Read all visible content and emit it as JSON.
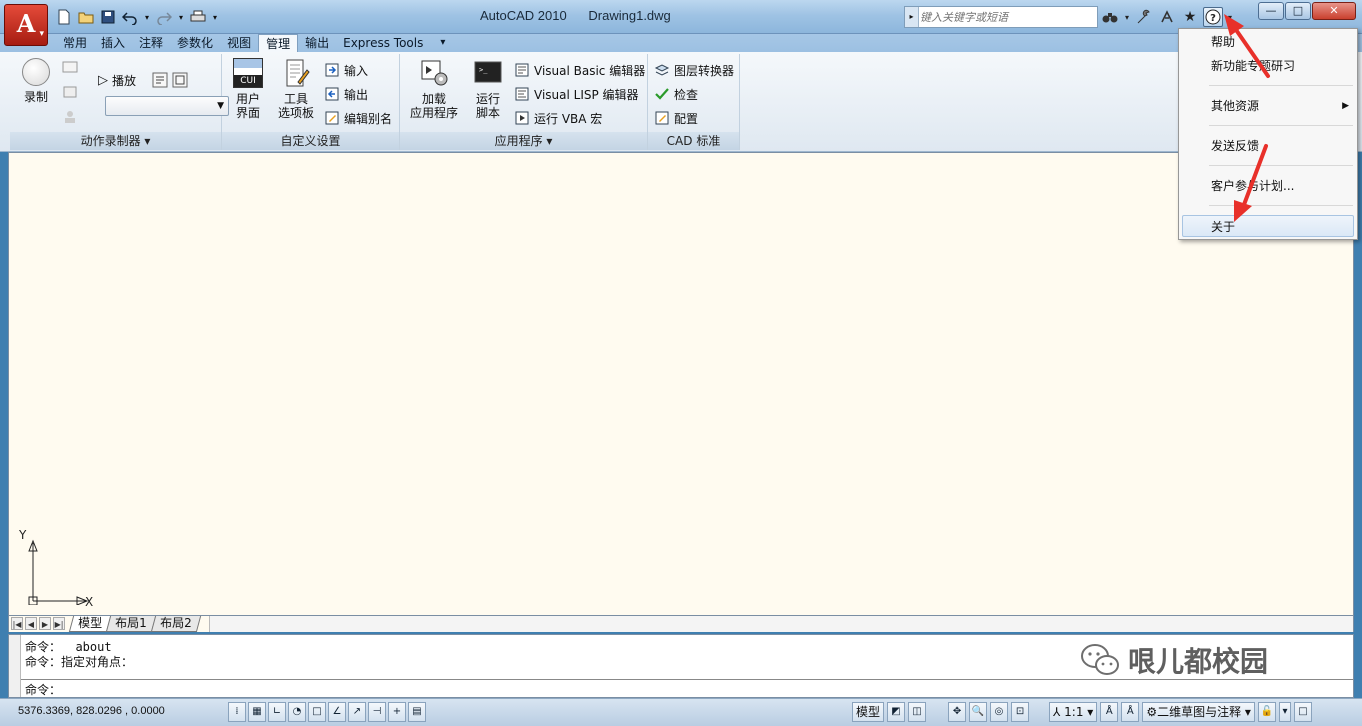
{
  "window": {
    "app_name": "AutoCAD 2010",
    "document": "Drawing1.dwg",
    "app_button_letter": "A",
    "minimize": "—",
    "maximize": "□",
    "close": "✕"
  },
  "search": {
    "placeholder": "键入关键字或短语"
  },
  "tabs": [
    "常用",
    "插入",
    "注释",
    "参数化",
    "视图",
    "管理",
    "输出",
    "Express Tools"
  ],
  "active_tab": "管理",
  "ribbon": {
    "record_label": "录制",
    "play_label": "播放",
    "cui_badge": "CUI",
    "user_interface_label": [
      "用户",
      "界面"
    ],
    "tool_palettes_label": [
      "工具",
      "选项板"
    ],
    "import_label": "输入",
    "export_label": "输出",
    "edit_alias_label": "编辑别名",
    "load_app_label": [
      "加载",
      "应用程序"
    ],
    "run_script_label": [
      "运行",
      "脚本"
    ],
    "vb_editor_label": "Visual Basic 编辑器",
    "lisp_editor_label": "Visual LISP 编辑器",
    "run_vba_label": "运行 VBA 宏",
    "layer_translator_label": "图层转换器",
    "check_label": "检查",
    "configure_label": "配置",
    "panels": {
      "action_recorder": "动作录制器",
      "customization": "自定义设置",
      "applications": "应用程序",
      "cad_standards": "CAD 标准"
    }
  },
  "help_menu": {
    "items": [
      "帮助",
      "新功能专题研习",
      "其他资源",
      "发送反馈",
      "客户参与计划...",
      "关于"
    ],
    "highlighted": "关于"
  },
  "ucs": {
    "y": "Y",
    "x": "X"
  },
  "layout_tabs": [
    "模型",
    "布局1",
    "布局2"
  ],
  "command": {
    "line1": "命令：  about",
    "line2": "命令：指定对角点：",
    "prompt": "命令："
  },
  "watermark": "哏儿都校园",
  "status": {
    "coords": "5376.3369, 828.0296 , 0.0000",
    "model": "模型",
    "scale": "1:1",
    "workspace": "二维草图与注释"
  },
  "colors": {
    "accent_red": "#e8302a",
    "canvas": "#fffbf0",
    "ribbon_blue": "#9cc0e2"
  }
}
